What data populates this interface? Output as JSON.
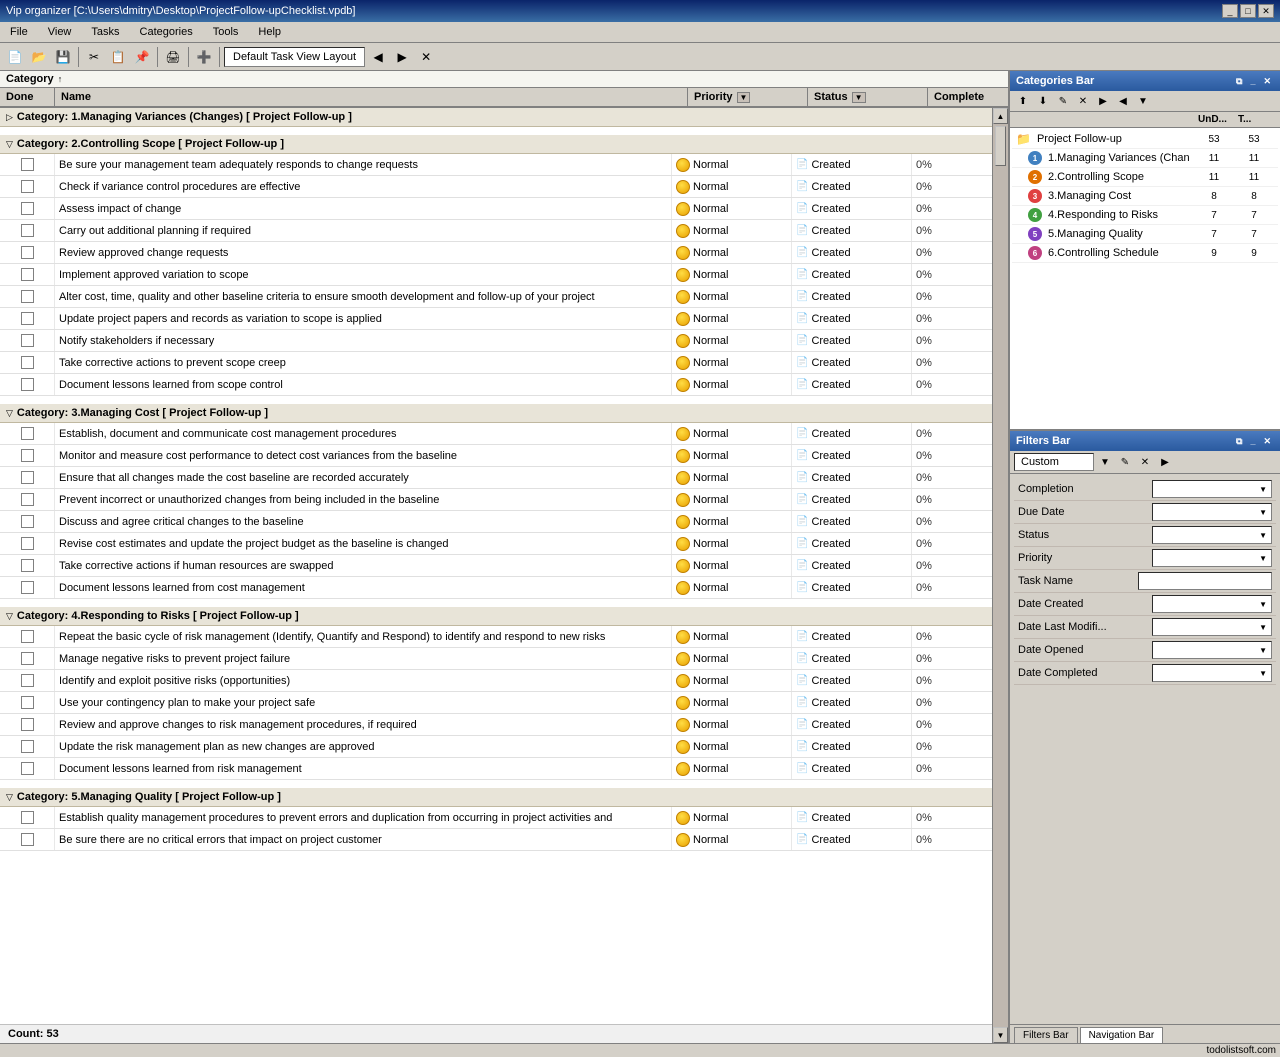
{
  "titleBar": {
    "title": "Vip organizer [C:\\Users\\dmitry\\Desktop\\ProjectFollow-upChecklist.vpdb]",
    "controls": [
      "minimize",
      "maximize",
      "close"
    ]
  },
  "menuBar": {
    "items": [
      "File",
      "View",
      "Tasks",
      "Categories",
      "Tools",
      "Help"
    ]
  },
  "toolbar": {
    "layout_label": "Default Task View Layout"
  },
  "categoryBar": {
    "label": "Category",
    "sort_indicator": "↑"
  },
  "tableHeaders": {
    "done": "Done",
    "name": "Name",
    "priority": "Priority",
    "status": "Status",
    "complete": "Complete"
  },
  "categories": [
    {
      "id": "cat1",
      "name": "Category: 1.Managing Variances (Changes)  [ Project Follow-up ]",
      "collapsed": true,
      "tasks": []
    },
    {
      "id": "cat2",
      "name": "Category: 2.Controlling Scope  [ Project Follow-up ]",
      "collapsed": false,
      "tasks": [
        {
          "name": "Be sure your management team adequately responds to change requests",
          "priority": "Normal",
          "status": "Created",
          "complete": "0%"
        },
        {
          "name": "Check if variance control procedures are effective",
          "priority": "Normal",
          "status": "Created",
          "complete": "0%"
        },
        {
          "name": "Assess impact of change",
          "priority": "Normal",
          "status": "Created",
          "complete": "0%"
        },
        {
          "name": "Carry out additional planning if required",
          "priority": "Normal",
          "status": "Created",
          "complete": "0%"
        },
        {
          "name": "Review approved change requests",
          "priority": "Normal",
          "status": "Created",
          "complete": "0%"
        },
        {
          "name": "Implement approved variation to scope",
          "priority": "Normal",
          "status": "Created",
          "complete": "0%"
        },
        {
          "name": "Alter cost, time, quality and other baseline criteria to ensure smooth development and follow-up of your project",
          "priority": "Normal",
          "status": "Created",
          "complete": "0%"
        },
        {
          "name": "Update project papers and records as variation to scope is applied",
          "priority": "Normal",
          "status": "Created",
          "complete": "0%"
        },
        {
          "name": "Notify stakeholders if necessary",
          "priority": "Normal",
          "status": "Created",
          "complete": "0%"
        },
        {
          "name": "Take corrective actions to prevent scope creep",
          "priority": "Normal",
          "status": "Created",
          "complete": "0%"
        },
        {
          "name": "Document lessons learned from scope control",
          "priority": "Normal",
          "status": "Created",
          "complete": "0%"
        }
      ]
    },
    {
      "id": "cat3",
      "name": "Category: 3.Managing Cost  [ Project Follow-up ]",
      "collapsed": false,
      "tasks": [
        {
          "name": "Establish, document and communicate cost management procedures",
          "priority": "Normal",
          "status": "Created",
          "complete": "0%"
        },
        {
          "name": "Monitor and measure cost performance to detect cost variances from the baseline",
          "priority": "Normal",
          "status": "Created",
          "complete": "0%"
        },
        {
          "name": "Ensure that all changes made the cost baseline are recorded accurately",
          "priority": "Normal",
          "status": "Created",
          "complete": "0%"
        },
        {
          "name": "Prevent incorrect or unauthorized changes from being included in the baseline",
          "priority": "Normal",
          "status": "Created",
          "complete": "0%"
        },
        {
          "name": "Discuss and agree critical changes to the baseline",
          "priority": "Normal",
          "status": "Created",
          "complete": "0%"
        },
        {
          "name": "Revise cost estimates and update the project budget as the baseline is changed",
          "priority": "Normal",
          "status": "Created",
          "complete": "0%"
        },
        {
          "name": "Take corrective actions if human resources are swapped",
          "priority": "Normal",
          "status": "Created",
          "complete": "0%"
        },
        {
          "name": "Document lessons learned from cost management",
          "priority": "Normal",
          "status": "Created",
          "complete": "0%"
        }
      ]
    },
    {
      "id": "cat4",
      "name": "Category: 4.Responding to Risks  [ Project Follow-up ]",
      "collapsed": false,
      "tasks": [
        {
          "name": "Repeat the basic cycle of risk management (Identify, Quantify and Respond) to identify and respond to new risks",
          "priority": "Normal",
          "status": "Created",
          "complete": "0%"
        },
        {
          "name": "Manage negative risks to prevent project failure",
          "priority": "Normal",
          "status": "Created",
          "complete": "0%"
        },
        {
          "name": "Identify and exploit positive risks (opportunities)",
          "priority": "Normal",
          "status": "Created",
          "complete": "0%"
        },
        {
          "name": "Use your contingency plan to make your project safe",
          "priority": "Normal",
          "status": "Created",
          "complete": "0%"
        },
        {
          "name": "Review and approve changes to risk management procedures, if required",
          "priority": "Normal",
          "status": "Created",
          "complete": "0%"
        },
        {
          "name": "Update the risk management plan as new changes are approved",
          "priority": "Normal",
          "status": "Created",
          "complete": "0%"
        },
        {
          "name": "Document lessons learned from risk management",
          "priority": "Normal",
          "status": "Created",
          "complete": "0%"
        }
      ]
    },
    {
      "id": "cat5",
      "name": "Category: 5.Managing Quality  [ Project Follow-up ]",
      "collapsed": false,
      "tasks": [
        {
          "name": "Establish quality management procedures to prevent errors and duplication from occurring in project activities and",
          "priority": "Normal",
          "status": "Created",
          "complete": "0%"
        },
        {
          "name": "Be sure there are no critical errors that impact on project customer",
          "priority": "Normal",
          "status": "Created",
          "complete": "0%"
        }
      ]
    }
  ],
  "footer": {
    "count_label": "Count: 53"
  },
  "categoriesPanel": {
    "title": "Categories Bar",
    "header": {
      "col1": "UnD...",
      "col2": "T..."
    },
    "items": [
      {
        "name": "Project Follow-up",
        "col1": "53",
        "col2": "53",
        "level": 0,
        "icon": "folder",
        "color": "#c8a000"
      },
      {
        "name": "1.Managing Variances (Chan",
        "col1": "11",
        "col2": "11",
        "level": 1,
        "icon": "num",
        "numColor": "#4080c0",
        "num": "1"
      },
      {
        "name": "2.Controlling Scope",
        "col1": "11",
        "col2": "11",
        "level": 1,
        "icon": "num",
        "numColor": "#e07000",
        "num": "2"
      },
      {
        "name": "3.Managing Cost",
        "col1": "8",
        "col2": "8",
        "level": 1,
        "icon": "num",
        "numColor": "#e04040",
        "num": "3"
      },
      {
        "name": "4.Responding to Risks",
        "col1": "7",
        "col2": "7",
        "level": 1,
        "icon": "num",
        "numColor": "#40a040",
        "num": "4"
      },
      {
        "name": "5.Managing Quality",
        "col1": "7",
        "col2": "7",
        "level": 1,
        "icon": "num",
        "numColor": "#8040c0",
        "num": "5"
      },
      {
        "name": "6.Controlling Schedule",
        "col1": "9",
        "col2": "9",
        "level": 1,
        "icon": "num",
        "numColor": "#c04080",
        "num": "6"
      }
    ]
  },
  "filtersPanel": {
    "title": "Filters Bar",
    "filter_name": "Custom",
    "filters": [
      {
        "label": "Completion",
        "type": "select",
        "value": ""
      },
      {
        "label": "Due Date",
        "type": "select",
        "value": ""
      },
      {
        "label": "Status",
        "type": "select",
        "value": ""
      },
      {
        "label": "Priority",
        "type": "select",
        "value": ""
      },
      {
        "label": "Task Name",
        "type": "text",
        "value": ""
      },
      {
        "label": "Date Created",
        "type": "select",
        "value": ""
      },
      {
        "label": "Date Last Modifi...",
        "type": "select",
        "value": ""
      },
      {
        "label": "Date Opened",
        "type": "select",
        "value": ""
      },
      {
        "label": "Date Completed",
        "type": "select",
        "value": ""
      }
    ],
    "tabs": [
      "Filters Bar",
      "Navigation Bar"
    ]
  },
  "statusBar": {
    "website": "todolistsoft.com"
  }
}
